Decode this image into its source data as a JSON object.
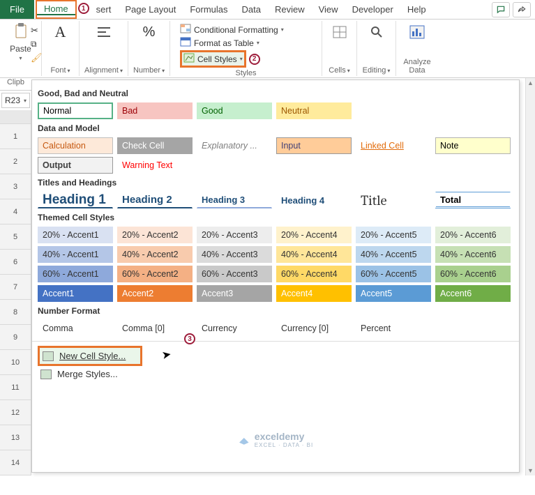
{
  "titlebar": {
    "file": "File",
    "tabs": [
      "Home",
      "sert",
      "Page Layout",
      "Formulas",
      "Data",
      "Review",
      "View",
      "Developer",
      "Help"
    ],
    "active_tab_index": 0
  },
  "annotations": {
    "a1": "1",
    "a2": "2",
    "a3": "3"
  },
  "ribbon": {
    "paste": "Paste",
    "groups": {
      "clipboard": "Clipb",
      "font": "Font",
      "alignment": "Alignment",
      "number": "Number",
      "styles": "Styles",
      "cells": "Cells",
      "editing": "Editing",
      "analyze": "Analyze Data"
    },
    "styles_items": {
      "cond_fmt": "Conditional Formatting",
      "fmt_table": "Format as Table",
      "cell_styles": "Cell Styles"
    }
  },
  "namebox": "R23",
  "row_headers": [
    "",
    "1",
    "2",
    "3",
    "4",
    "5",
    "6",
    "7",
    "8",
    "9",
    "10",
    "11",
    "12",
    "13",
    "14"
  ],
  "gallery": {
    "sec_gbn": "Good, Bad and Neutral",
    "gbn": [
      {
        "t": "Normal",
        "bg": "#ffffff",
        "fg": "#000",
        "sel": true
      },
      {
        "t": "Bad",
        "bg": "#f7c5c1",
        "fg": "#9c0006"
      },
      {
        "t": "Good",
        "bg": "#c6efce",
        "fg": "#006100"
      },
      {
        "t": "Neutral",
        "bg": "#ffeb9c",
        "fg": "#9c5700"
      }
    ],
    "sec_dam": "Data and Model",
    "dam1": [
      {
        "t": "Calculation",
        "bg": "#fde9d9",
        "fg": "#c65911",
        "bd": "#bfbfbf"
      },
      {
        "t": "Check Cell",
        "bg": "#a5a5a5",
        "fg": "#ffffff"
      },
      {
        "t": "Explanatory ...",
        "bg": "#ffffff",
        "fg": "#7f7f7f",
        "it": true
      },
      {
        "t": "Input",
        "bg": "#ffcc99",
        "fg": "#3f3f76",
        "bd": "#999"
      },
      {
        "t": "Linked Cell",
        "bg": "#ffffff",
        "fg": "#e26b0a",
        "ul": true
      },
      {
        "t": "Note",
        "bg": "#ffffcc",
        "fg": "#000",
        "bd": "#b2b2b2"
      }
    ],
    "dam2": [
      {
        "t": "Output",
        "bg": "#f2f2f2",
        "fg": "#3f3f3f",
        "bd": "#999",
        "bold": true
      },
      {
        "t": "Warning Text",
        "bg": "#ffffff",
        "fg": "#ff0000"
      }
    ],
    "sec_th": "Titles and Headings",
    "titles": [
      "Heading 1",
      "Heading 2",
      "Heading 3",
      "Heading 4",
      "Title",
      "Total"
    ],
    "sec_themed": "Themed Cell Styles",
    "accents": {
      "r20": [
        {
          "t": "20% - Accent1",
          "bg": "#d9e1f2"
        },
        {
          "t": "20% - Accent2",
          "bg": "#fce4d6"
        },
        {
          "t": "20% - Accent3",
          "bg": "#ededed"
        },
        {
          "t": "20% - Accent4",
          "bg": "#fff2cc"
        },
        {
          "t": "20% - Accent5",
          "bg": "#ddebf7"
        },
        {
          "t": "20% - Accent6",
          "bg": "#e2efda"
        }
      ],
      "r40": [
        {
          "t": "40% - Accent1",
          "bg": "#b4c6e7"
        },
        {
          "t": "40% - Accent2",
          "bg": "#f8cbad"
        },
        {
          "t": "40% - Accent3",
          "bg": "#dbdbdb"
        },
        {
          "t": "40% - Accent4",
          "bg": "#ffe699"
        },
        {
          "t": "40% - Accent5",
          "bg": "#bdd7ee"
        },
        {
          "t": "40% - Accent6",
          "bg": "#c6e0b4"
        }
      ],
      "r60": [
        {
          "t": "60% - Accent1",
          "bg": "#8ea9db"
        },
        {
          "t": "60% - Accent2",
          "bg": "#f4b084"
        },
        {
          "t": "60% - Accent3",
          "bg": "#c9c9c9"
        },
        {
          "t": "60% - Accent4",
          "bg": "#ffd966"
        },
        {
          "t": "60% - Accent5",
          "bg": "#9bc2e6"
        },
        {
          "t": "60% - Accent6",
          "bg": "#a9d08e"
        }
      ],
      "r100": [
        {
          "t": "Accent1",
          "bg": "#4472c4",
          "fg": "#fff"
        },
        {
          "t": "Accent2",
          "bg": "#ed7d31",
          "fg": "#fff"
        },
        {
          "t": "Accent3",
          "bg": "#a5a5a5",
          "fg": "#fff"
        },
        {
          "t": "Accent4",
          "bg": "#ffc000",
          "fg": "#fff"
        },
        {
          "t": "Accent5",
          "bg": "#5b9bd5",
          "fg": "#fff"
        },
        {
          "t": "Accent6",
          "bg": "#70ad47",
          "fg": "#fff"
        }
      ]
    },
    "sec_nf": "Number Format",
    "nf": [
      "Comma",
      "Comma [0]",
      "Currency",
      "Currency [0]",
      "Percent"
    ],
    "menu": {
      "new_style": "New Cell Style...",
      "merge": "Merge Styles..."
    }
  },
  "watermark": {
    "brand": "exceldemy",
    "tag": "EXCEL · DATA · BI"
  }
}
